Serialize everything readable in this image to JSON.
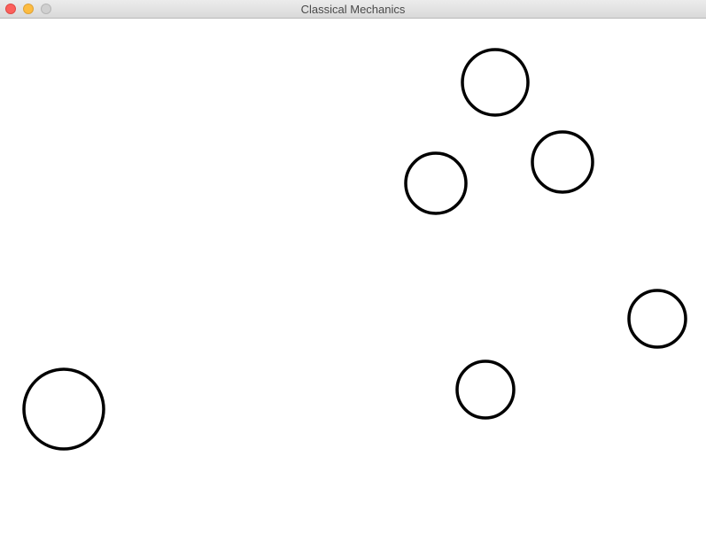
{
  "window": {
    "title": "Classical Mechanics"
  },
  "colors": {
    "ball_stroke": "#000000",
    "canvas_background": "#ffffff"
  },
  "balls_count": 6
}
